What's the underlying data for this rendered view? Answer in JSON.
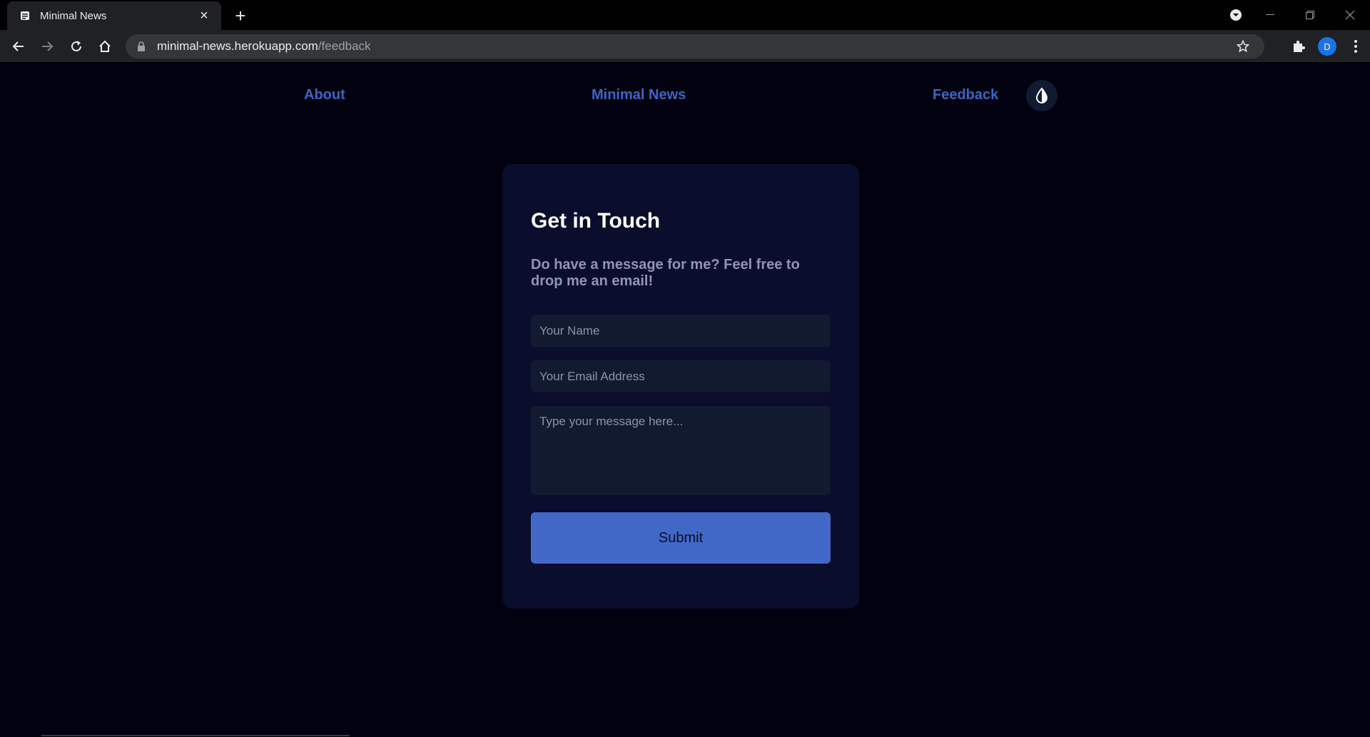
{
  "browser": {
    "tab_title": "Minimal News",
    "url_host": "minimal-news.herokuapp.com",
    "url_path": "/feedback",
    "profile_initial": "D",
    "colors": {
      "avatar": "#1a73e8"
    }
  },
  "nav": {
    "about": "About",
    "brand": "Minimal News",
    "feedback": "Feedback"
  },
  "form": {
    "title": "Get in Touch",
    "subtitle": "Do have a message for me? Feel free to drop me an email!",
    "name_placeholder": "Your Name",
    "email_placeholder": "Your Email Address",
    "message_placeholder": "Type your message here...",
    "submit_label": "Submit"
  },
  "colors": {
    "page_bg": "#01010f",
    "card_bg": "#0a0d2b",
    "link": "#3f65c4",
    "button": "#4268c7",
    "input_bg": "#111a2e"
  }
}
